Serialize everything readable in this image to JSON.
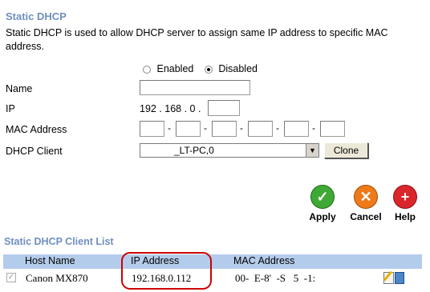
{
  "static_dhcp": {
    "title": "Static DHCP",
    "description": "Static DHCP is used to allow DHCP server to assign same IP address to specific MAC address.",
    "enabled_label": "Enabled",
    "disabled_label": "Disabled",
    "selected": "Disabled",
    "fields": {
      "name_label": "Name",
      "name_value": "",
      "ip_label": "IP",
      "ip_prefix": "192 . 168 . 0 .",
      "ip_last_octet": "",
      "mac_label": "MAC Address",
      "mac_separator": "-",
      "client_label": "DHCP Client",
      "client_selected": "_LT-PC,0",
      "clone_label": "Clone"
    }
  },
  "actions": {
    "apply_label": "Apply",
    "cancel_label": "Cancel",
    "help_label": "Help"
  },
  "client_list": {
    "title": "Static DHCP Client List",
    "headers": [
      "Host Name",
      "IP Address",
      "MAC Address"
    ],
    "rows": [
      {
        "checked": true,
        "host": "Canon MX870",
        "ip": "192.168.0.112",
        "mac": "00-  E-8'  -S   5  -1:"
      }
    ]
  },
  "colors": {
    "section_title": "#6f8fc0",
    "list_header_bg": "#b4cceb",
    "highlight_circle": "#cc0000",
    "apply": "#3fa935",
    "cancel": "#ee7a1a",
    "help": "#d9262b"
  }
}
